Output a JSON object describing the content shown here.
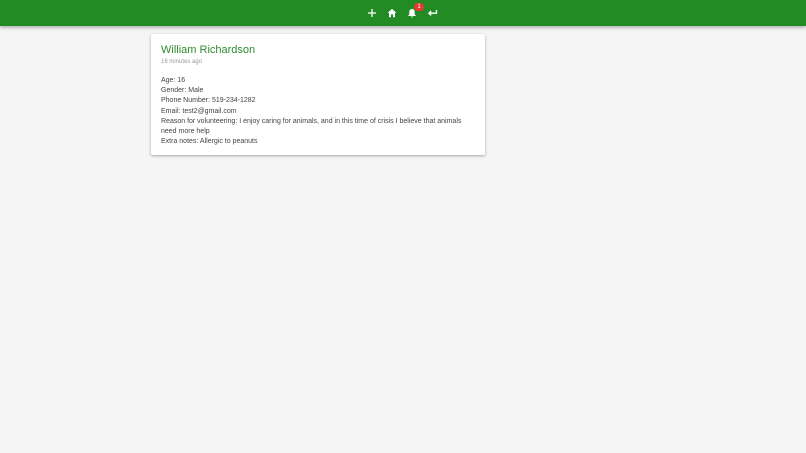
{
  "nav": {
    "add_icon": "plus-icon",
    "home_icon": "home-icon",
    "notifications_icon": "bell-icon",
    "notifications_count": "1",
    "back_icon": "return-arrow-icon"
  },
  "colors": {
    "topbar": "#238b23",
    "name": "#2e8b2e",
    "badge": "#e53935"
  },
  "volunteer": {
    "name": "William Richardson",
    "posted": "16 minutes ago",
    "age": "Age: 16",
    "gender": "Gender: Male",
    "phone": "Phone Number: 519-234-1282",
    "email": "Email: test2@gmail.com",
    "reason": "Reason for volunteering: I enjoy caring for animals, and in this time of crisis I believe that animals need more help",
    "notes": "Extra notes: Allergic to peanuts"
  }
}
